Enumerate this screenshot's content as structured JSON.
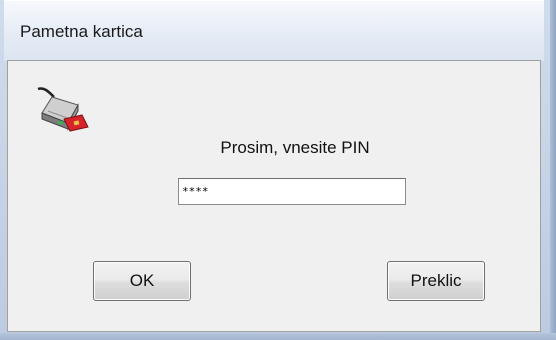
{
  "window": {
    "title": "Pametna kartica"
  },
  "dialog": {
    "prompt": "Prosim, vnesite PIN",
    "pin_value": "****",
    "ok_label": "OK",
    "cancel_label": "Preklic"
  },
  "icons": {
    "card_reader": "smart-card-reader-icon"
  },
  "colors": {
    "window_frame": "#c7d3e3",
    "client_background": "#f0f0f0",
    "card_red": "#d8232a"
  }
}
